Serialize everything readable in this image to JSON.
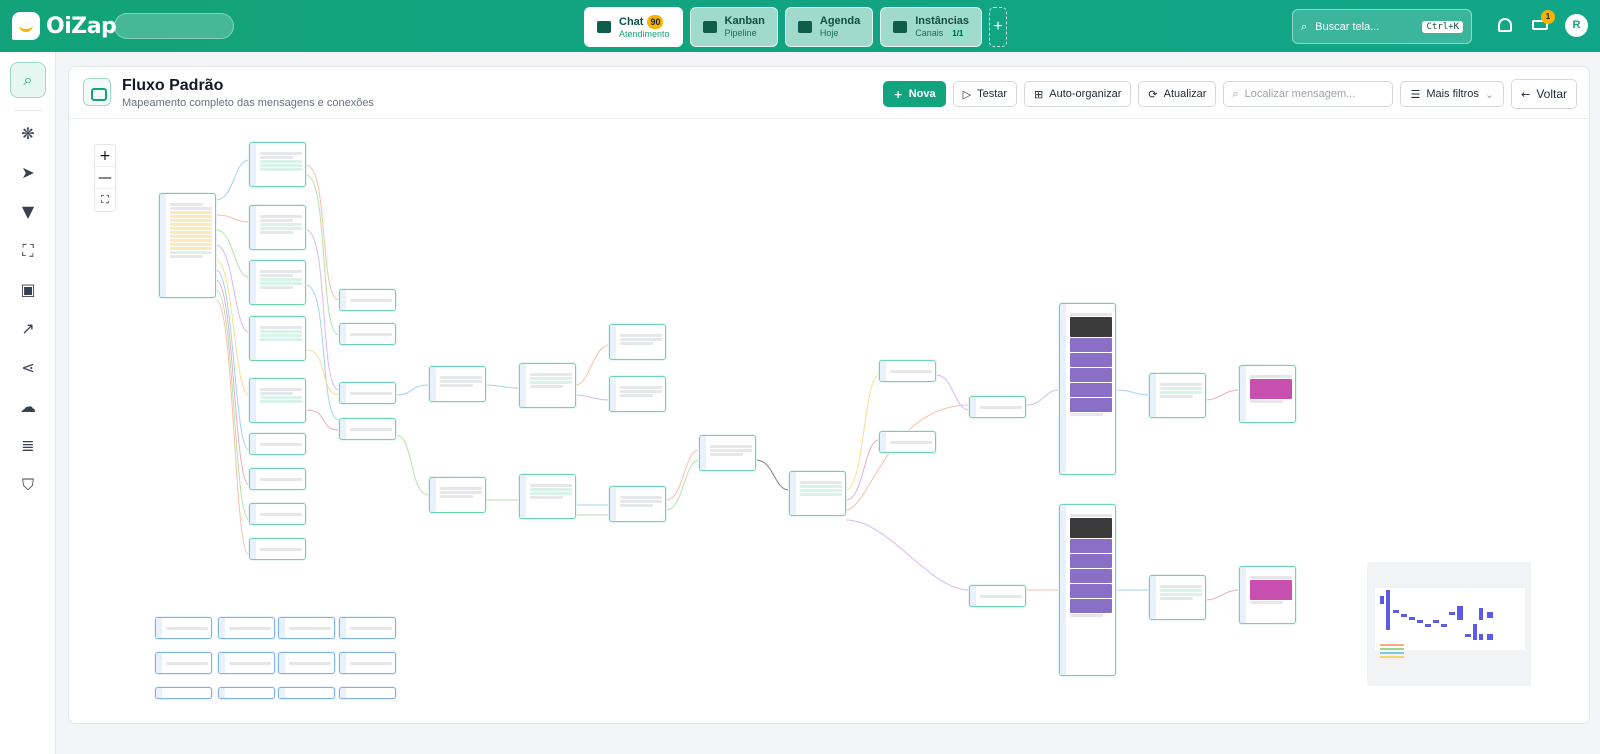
{
  "app": {
    "name": "OiZap"
  },
  "nav": {
    "tabs": [
      {
        "title": "Chat",
        "sub": "Atendimento",
        "badge": "90"
      },
      {
        "title": "Kanban",
        "sub": "Pipeline"
      },
      {
        "title": "Agenda",
        "sub": "Hoje"
      },
      {
        "title": "Instâncias",
        "sub": "Canais",
        "badge": "1/1"
      }
    ],
    "add_label": "+"
  },
  "search": {
    "placeholder": "Buscar tela...",
    "shortcut": "Ctrl+K"
  },
  "notifications": {
    "truck_badge": "1"
  },
  "user": {
    "initial": "R"
  },
  "sidebar": {
    "items": [
      {
        "icon": "search-icon",
        "glyph": "🔍"
      },
      {
        "icon": "brain-icon",
        "glyph": "❋"
      },
      {
        "icon": "send-icon",
        "glyph": "➤"
      },
      {
        "icon": "funnel-icon",
        "glyph": "▼"
      },
      {
        "icon": "scan-icon",
        "glyph": "⛶"
      },
      {
        "icon": "briefcase-icon",
        "glyph": "▣"
      },
      {
        "icon": "chart-icon",
        "glyph": "↗"
      },
      {
        "icon": "share-icon",
        "glyph": "⋖"
      },
      {
        "icon": "cloud-icon",
        "glyph": "☁"
      },
      {
        "icon": "stack-icon",
        "glyph": "≣"
      },
      {
        "icon": "shield-user-icon",
        "glyph": "⛉"
      }
    ]
  },
  "page": {
    "title": "Fluxo Padrão",
    "subtitle": "Mapeamento completo das mensagens e conexões"
  },
  "toolbar": {
    "new_label": "Nova",
    "test_label": "Testar",
    "auto_label": "Auto-organizar",
    "refresh_label": "Atualizar",
    "find_placeholder": "Localizar mensagem...",
    "filters_label": "Mais filtros",
    "back_label": "Voltar"
  },
  "zoom": {
    "in": "+",
    "out": "—",
    "fit": "⛶"
  },
  "colors": {
    "brand": "#12a47f",
    "accent": "#f4b400",
    "node_green": "#6dd3b0",
    "node_blue": "#7eb2e8"
  }
}
